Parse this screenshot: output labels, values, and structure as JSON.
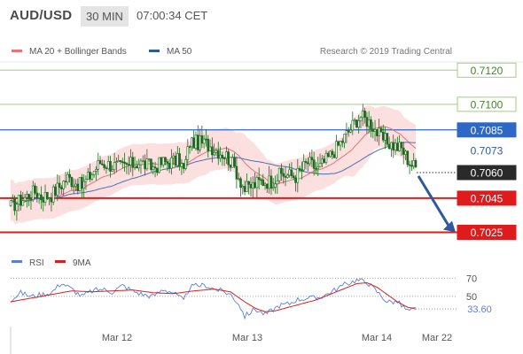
{
  "header": {
    "symbol": "AUD/USD",
    "timeframe": "30 MIN",
    "time": "07:00:34 CET"
  },
  "legend": {
    "ma20_label": "MA 20 + Bollinger Bands",
    "ma50_label": "MA 50",
    "source": "Research © 2019 Trading Central",
    "rsi_label": "RSI",
    "rsi_ma_label": "9MA"
  },
  "colors": {
    "candle": "#1f6b1f",
    "ma20": "#e8727a",
    "bollinger_fill": "#fcd9d9",
    "ma50": "#4a6fb5",
    "resistance": "#9ed27a",
    "pivot": "#2e67c6",
    "support": "#e01b1b",
    "rsi": "#5b7fd6",
    "rsi_ma": "#d62020",
    "arrow": "#2e5a9c",
    "last_price": "#2a2a2a"
  },
  "chart_data": [
    {
      "type": "candlestick",
      "ylim": [
        0.7018,
        0.713
      ],
      "x_ticks": [
        "Mar 12",
        "Mar 13",
        "Mar 14",
        "Mar 22"
      ],
      "levels": [
        {
          "value": 0.712,
          "label": "0.7120",
          "kind": "resistance"
        },
        {
          "value": 0.71,
          "label": "0.7100",
          "kind": "resistance"
        },
        {
          "value": 0.7085,
          "label": "0.7085",
          "kind": "pivot"
        },
        {
          "value": 0.7073,
          "label": "0.7073",
          "kind": "ma-value"
        },
        {
          "value": 0.706,
          "label": "0.7060",
          "kind": "last-price"
        },
        {
          "value": 0.7045,
          "label": "0.7045",
          "kind": "support"
        },
        {
          "value": 0.7025,
          "label": "0.7025",
          "kind": "support"
        }
      ],
      "forecast": {
        "from": 0.7058,
        "to": 0.7025
      },
      "close_keys": [
        [
          0,
          0.704
        ],
        [
          5,
          0.7044
        ],
        [
          12,
          0.7049
        ],
        [
          15,
          0.7046
        ],
        [
          20,
          0.7047
        ],
        [
          28,
          0.7057
        ],
        [
          35,
          0.7052
        ],
        [
          44,
          0.7066
        ],
        [
          54,
          0.7063
        ],
        [
          63,
          0.7066
        ],
        [
          70,
          0.7063
        ],
        [
          75,
          0.7066
        ],
        [
          83,
          0.7067
        ],
        [
          85,
          0.7061
        ],
        [
          88,
          0.7078
        ],
        [
          96,
          0.7077
        ],
        [
          103,
          0.7072
        ],
        [
          106,
          0.707
        ],
        [
          110,
          0.7063
        ],
        [
          115,
          0.705
        ],
        [
          123,
          0.7055
        ],
        [
          128,
          0.7055
        ],
        [
          133,
          0.7059
        ],
        [
          140,
          0.7058
        ],
        [
          146,
          0.7066
        ],
        [
          151,
          0.7062
        ],
        [
          157,
          0.707
        ],
        [
          163,
          0.7079
        ],
        [
          170,
          0.7091
        ],
        [
          172,
          0.7093
        ],
        [
          177,
          0.7089
        ],
        [
          182,
          0.708
        ],
        [
          188,
          0.7076
        ],
        [
          192,
          0.7074
        ],
        [
          196,
          0.7066
        ],
        [
          199,
          0.7063
        ]
      ]
    },
    {
      "type": "line",
      "ylim": [
        0,
        100
      ],
      "y_ticks": [
        70,
        50
      ],
      "current_label": "33.60",
      "rsi_keys": [
        [
          0,
          46
        ],
        [
          5,
          54
        ],
        [
          10,
          50
        ],
        [
          15,
          52
        ],
        [
          20,
          54
        ],
        [
          25,
          65
        ],
        [
          30,
          58
        ],
        [
          35,
          50
        ],
        [
          40,
          56
        ],
        [
          45,
          58
        ],
        [
          50,
          55
        ],
        [
          55,
          62
        ],
        [
          60,
          56
        ],
        [
          65,
          52
        ],
        [
          70,
          50
        ],
        [
          75,
          58
        ],
        [
          80,
          54
        ],
        [
          85,
          45
        ],
        [
          88,
          60
        ],
        [
          92,
          62
        ],
        [
          96,
          62
        ],
        [
          100,
          58
        ],
        [
          104,
          56
        ],
        [
          108,
          52
        ],
        [
          112,
          42
        ],
        [
          115,
          28
        ],
        [
          120,
          36
        ],
        [
          125,
          30
        ],
        [
          128,
          34
        ],
        [
          132,
          40
        ],
        [
          137,
          42
        ],
        [
          140,
          46
        ],
        [
          145,
          48
        ],
        [
          150,
          48
        ],
        [
          155,
          52
        ],
        [
          160,
          58
        ],
        [
          165,
          64
        ],
        [
          170,
          68
        ],
        [
          175,
          66
        ],
        [
          180,
          55
        ],
        [
          185,
          44
        ],
        [
          190,
          44
        ],
        [
          195,
          34
        ],
        [
          199,
          36
        ]
      ],
      "ma_keys": [
        [
          0,
          44
        ],
        [
          10,
          48
        ],
        [
          20,
          52
        ],
        [
          30,
          56
        ],
        [
          40,
          55
        ],
        [
          50,
          56
        ],
        [
          60,
          57
        ],
        [
          70,
          54
        ],
        [
          80,
          53
        ],
        [
          90,
          56
        ],
        [
          100,
          58
        ],
        [
          108,
          55
        ],
        [
          115,
          44
        ],
        [
          120,
          37
        ],
        [
          125,
          33
        ],
        [
          130,
          34
        ],
        [
          140,
          40
        ],
        [
          150,
          46
        ],
        [
          160,
          55
        ],
        [
          170,
          64
        ],
        [
          175,
          65
        ],
        [
          180,
          60
        ],
        [
          185,
          52
        ],
        [
          190,
          44
        ],
        [
          195,
          38
        ],
        [
          199,
          36
        ]
      ]
    }
  ]
}
